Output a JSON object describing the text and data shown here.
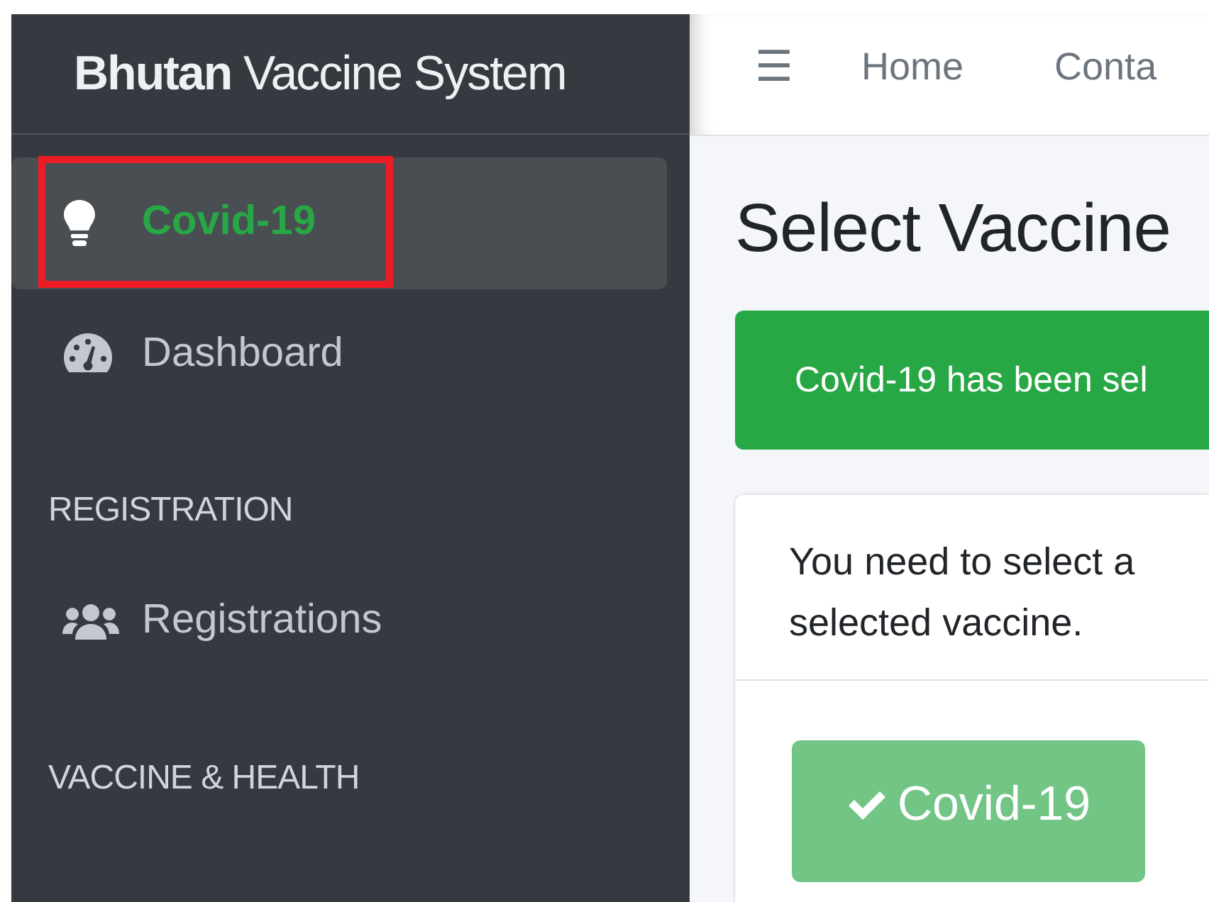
{
  "brand": {
    "bold": "Bhutan",
    "rest": "Vaccine System"
  },
  "navbar": {
    "menu_glyph": "☰",
    "links": [
      "Home",
      "Conta"
    ]
  },
  "sidebar": {
    "items": [
      {
        "kind": "link",
        "label": "Covid-19",
        "selected": true,
        "highlighted": true
      },
      {
        "kind": "link",
        "label": "Dashboard",
        "selected": false,
        "highlighted": false
      },
      {
        "kind": "header",
        "label": "REGISTRATION"
      },
      {
        "kind": "link",
        "label": "Registrations",
        "selected": false,
        "highlighted": false
      },
      {
        "kind": "header",
        "label": "VACCINE & HEALTH"
      }
    ]
  },
  "content": {
    "title": "Select Vaccine",
    "alert": "Covid-19 has been sel",
    "card": {
      "text": "You need to select a\nselected vaccine.",
      "button": {
        "label": "Covid-19",
        "disabled": true
      }
    }
  }
}
